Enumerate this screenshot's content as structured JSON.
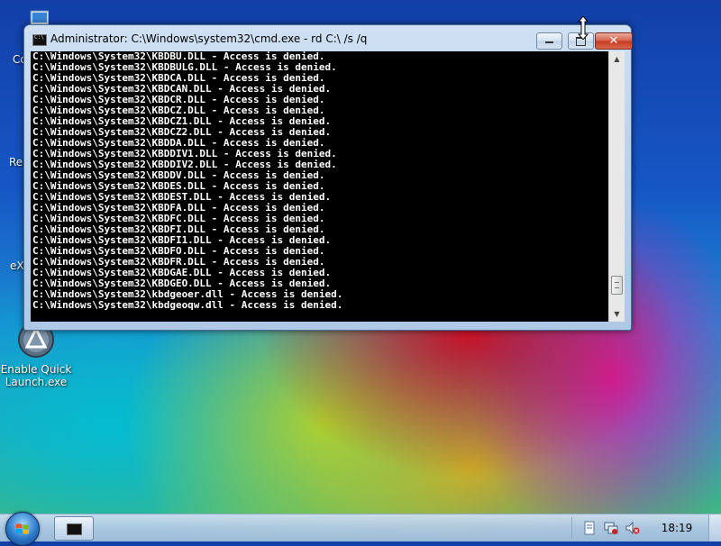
{
  "desktop": {
    "icons": [
      {
        "name": "computer",
        "label": "Co"
      },
      {
        "name": "recycle-bin",
        "label": "Rec"
      },
      {
        "name": "ex",
        "label": "eX"
      },
      {
        "name": "enable-quick-launch",
        "label": "Enable Quick Launch.exe"
      }
    ]
  },
  "window": {
    "title": "Administrator: C:\\Windows\\system32\\cmd.exe - rd  C:\\ /s /q",
    "controls": {
      "minimize": "",
      "maximize": "",
      "close": "✕"
    },
    "console_lines": [
      "C:\\Windows\\System32\\KBDBU.DLL - Access is denied.",
      "C:\\Windows\\System32\\KBDBULG.DLL - Access is denied.",
      "C:\\Windows\\System32\\KBDCA.DLL - Access is denied.",
      "C:\\Windows\\System32\\KBDCAN.DLL - Access is denied.",
      "C:\\Windows\\System32\\KBDCR.DLL - Access is denied.",
      "C:\\Windows\\System32\\KBDCZ.DLL - Access is denied.",
      "C:\\Windows\\System32\\KBDCZ1.DLL - Access is denied.",
      "C:\\Windows\\System32\\KBDCZ2.DLL - Access is denied.",
      "C:\\Windows\\System32\\KBDDA.DLL - Access is denied.",
      "C:\\Windows\\System32\\KBDDIV1.DLL - Access is denied.",
      "C:\\Windows\\System32\\KBDDIV2.DLL - Access is denied.",
      "C:\\Windows\\System32\\KBDDV.DLL - Access is denied.",
      "C:\\Windows\\System32\\KBDES.DLL - Access is denied.",
      "C:\\Windows\\System32\\KBDEST.DLL - Access is denied.",
      "C:\\Windows\\System32\\KBDFA.DLL - Access is denied.",
      "C:\\Windows\\System32\\KBDFC.DLL - Access is denied.",
      "C:\\Windows\\System32\\KBDFI.DLL - Access is denied.",
      "C:\\Windows\\System32\\KBDFI1.DLL - Access is denied.",
      "C:\\Windows\\System32\\KBDFO.DLL - Access is denied.",
      "C:\\Windows\\System32\\KBDFR.DLL - Access is denied.",
      "C:\\Windows\\System32\\KBDGAE.DLL - Access is denied.",
      "C:\\Windows\\System32\\KBDGEO.DLL - Access is denied.",
      "C:\\Windows\\System32\\kbdgeoer.dll - Access is denied.",
      "C:\\Windows\\System32\\kbdgeoqw.dll - Access is denied."
    ],
    "scroll_position": 0.94
  },
  "taskbar": {
    "clock": "18:19",
    "task_buttons": [
      {
        "name": "cmd"
      }
    ],
    "tray_icons": [
      "action-center-icon",
      "network-icon",
      "volume-muted-icon"
    ]
  }
}
